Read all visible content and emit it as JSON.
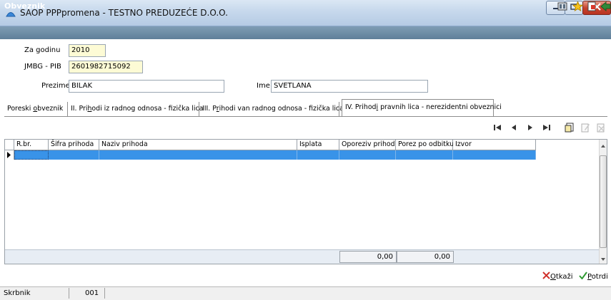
{
  "window": {
    "title": "SAOP PPPpromena - TESTNO PREDUZEĆE D.O.O."
  },
  "header": {
    "title": "Obveznik",
    "icons": [
      "settings-icon",
      "star-icon",
      "document-icon",
      "exit-icon"
    ]
  },
  "form": {
    "year_label": "Za godinu",
    "year_value": "2010",
    "jmbg_label": "JMBG - PIB",
    "jmbg_value": "2601982715092",
    "surname_label": "Prezime",
    "surname_value": "BILAK",
    "name_label": "Ime",
    "name_value": "SVETLANA"
  },
  "tabs": [
    {
      "label_pre": "Poreski ",
      "label_u": "o",
      "label_post": "bveznik"
    },
    {
      "label_pre": "II. Pri",
      "label_u": "h",
      "label_post": "odi iz radnog odnosa - fizička lica"
    },
    {
      "label_pre": "III. P",
      "label_u": "r",
      "label_post": "ihodi van radnog odnosa - fizička lica"
    },
    {
      "label_pre": "IV. Prihod",
      "label_u": "i",
      "label_post": " pravnih lica - nerezidentni obveznici"
    }
  ],
  "toolbar": {
    "icons": [
      "first-record-icon",
      "previous-record-icon",
      "next-record-icon",
      "last-record-icon",
      "new-record-icon",
      "edit-record-icon",
      "delete-record-icon"
    ]
  },
  "grid": {
    "columns": [
      "R.br.",
      "Šifra prihoda",
      "Naziv prihoda",
      "Isplata",
      "Oporeziv prihod",
      "Porez po odbitku",
      "Izvor"
    ],
    "totals": {
      "oporeziv_prihod": "0,00",
      "porez_po_odbitku": "0,00"
    }
  },
  "buttons": {
    "cancel_u": "O",
    "cancel_rest": "tkaži",
    "confirm_u": "P",
    "confirm_rest": "otrdi"
  },
  "statusbar": {
    "label": "Skrbnik",
    "value": "001"
  },
  "colors": {
    "header_bar": "#6d8ca5",
    "selected_row": "#3993e8",
    "highlight_field": "#fdfbd5"
  }
}
